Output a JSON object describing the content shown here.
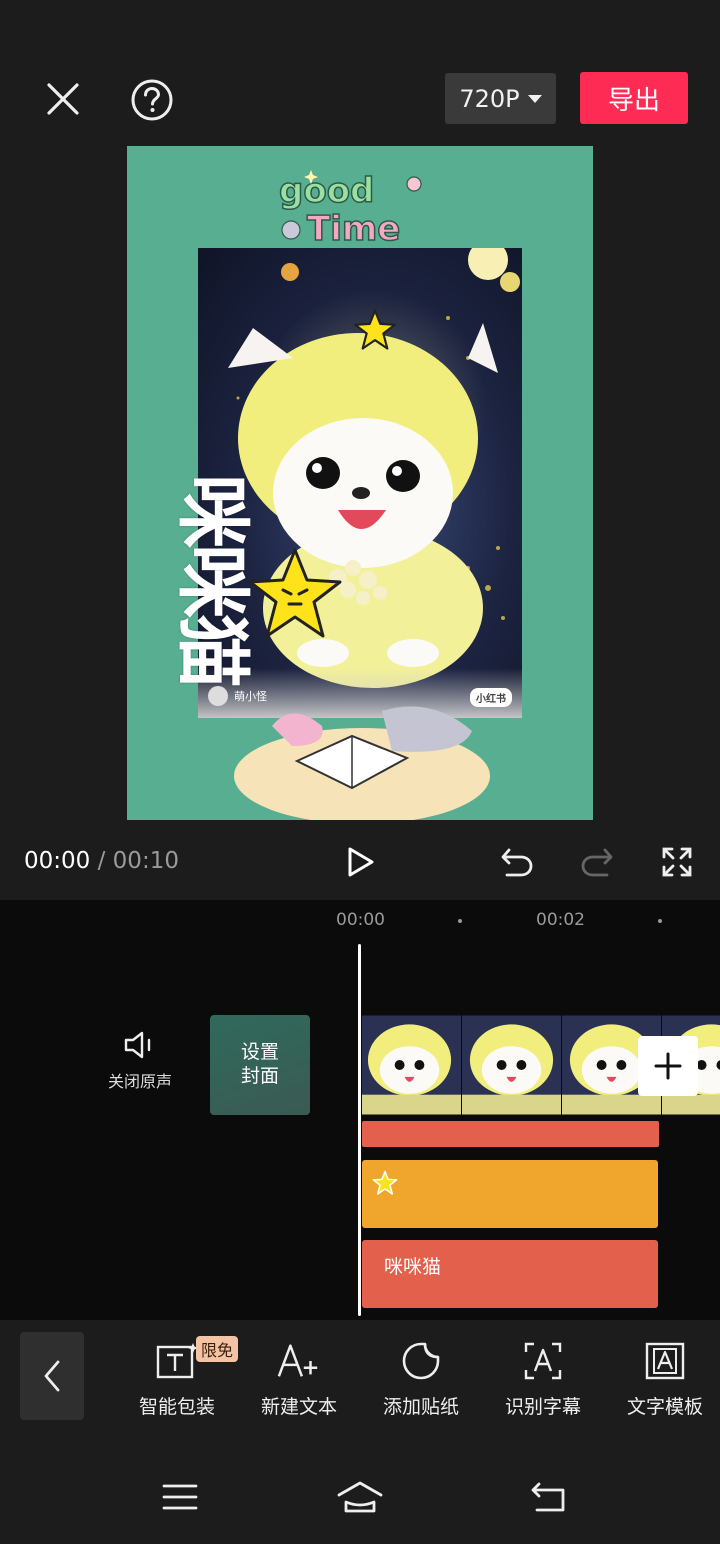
{
  "topbar": {
    "resolution": "720P",
    "export_label": "导出"
  },
  "preview": {
    "deco_title": "good Time",
    "overlay_text": [
      "咪",
      "咪",
      "猫"
    ],
    "watermark_user": "萌小怪",
    "watermark_brand": "小红书"
  },
  "playback": {
    "current_time": "00:00",
    "separator": "/",
    "total_time": "00:10"
  },
  "timeline": {
    "ruler": [
      "00:00",
      "00:02"
    ],
    "mute_label": "关闭原声",
    "cover_label": "设置\n封面",
    "text_track_label": "咪咪猫"
  },
  "toolbar": {
    "badge": "限免",
    "items": [
      {
        "label": "智能包装",
        "icon": "smart-package-icon"
      },
      {
        "label": "新建文本",
        "icon": "new-text-icon"
      },
      {
        "label": "添加贴纸",
        "icon": "sticker-icon"
      },
      {
        "label": "识别字幕",
        "icon": "caption-recognition-icon"
      },
      {
        "label": "文字模板",
        "icon": "text-template-icon"
      }
    ]
  },
  "colors": {
    "accent": "#fe2c55",
    "preview_bg": "#58ae90",
    "effect_track": "#e3604c",
    "sticker_track": "#f0a52c"
  }
}
